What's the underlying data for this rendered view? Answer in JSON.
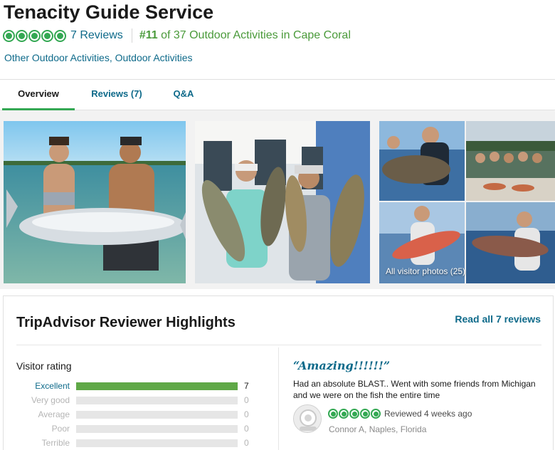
{
  "listing": {
    "title": "Tenacity Guide Service",
    "review_count": "7 Reviews",
    "rank_number": "#11",
    "rank_text": "of 37 Outdoor Activities in Cape Coral",
    "categories": "Other Outdoor Activities, Outdoor Activities",
    "bubble_rating": 5
  },
  "tabs": [
    {
      "label": "Overview",
      "active": true
    },
    {
      "label": "Reviews (7)",
      "active": false
    },
    {
      "label": "Q&A",
      "active": false
    }
  ],
  "gallery": {
    "visitor_photos_label": "All visitor photos (25)"
  },
  "highlights": {
    "title": "TripAdvisor Reviewer Highlights",
    "read_all": "Read all 7 reviews",
    "visitor_rating_title": "Visitor rating",
    "ratings": [
      {
        "label": "Excellent",
        "count": "7",
        "fraction": 1.0
      },
      {
        "label": "Very good",
        "count": "0",
        "fraction": 0
      },
      {
        "label": "Average",
        "count": "0",
        "fraction": 0
      },
      {
        "label": "Poor",
        "count": "0",
        "fraction": 0
      },
      {
        "label": "Terrible",
        "count": "0",
        "fraction": 0
      }
    ],
    "review": {
      "quote": "“Amazing!!!!!!”",
      "snippet": "Had an absolute BLAST.. Went with some friends from Michigan and we were on the fish the entire time",
      "bubble_rating": 5,
      "reviewed": "Reviewed 4 weeks ago",
      "reviewer": "Connor A, Naples, Florida"
    }
  },
  "colors": {
    "brand_green": "#34a853",
    "link_blue": "#0e6a8a",
    "bar_fill": "#5fa847"
  }
}
